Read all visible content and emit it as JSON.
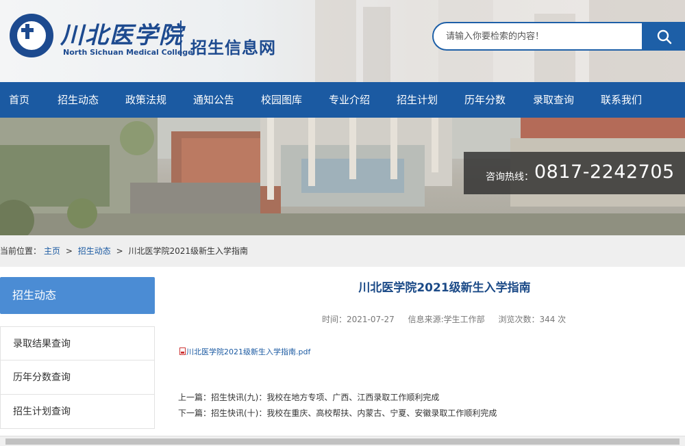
{
  "header": {
    "logo_cn": "川北医学院",
    "logo_en": "North Sichuan Medical College",
    "site_title": "招生信息网",
    "search_placeholder": "请输入你要检索的内容！"
  },
  "nav": {
    "items": [
      "首页",
      "招生动态",
      "政策法规",
      "通知公告",
      "校园图库",
      "专业介绍",
      "招生计划",
      "历年分数",
      "录取查询",
      "联系我们"
    ]
  },
  "banner": {
    "hotline_label": "咨询热线：",
    "hotline_number": "0817-2242705"
  },
  "breadcrumb": {
    "prefix": "当前位置：",
    "home": "主页",
    "sep": ">",
    "section": "招生动态",
    "current": "川北医学院2021级新生入学指南"
  },
  "sidebar": {
    "heading": "招生动态",
    "items": [
      "录取结果查询",
      "历年分数查询",
      "招生计划查询"
    ]
  },
  "article": {
    "title": "川北医学院2021级新生入学指南",
    "time": "时间：2021-07-27",
    "source": "信息来源:学生工作部",
    "views": "浏览次数：344 次",
    "attachment": "川北医学院2021级新生入学指南.pdf",
    "prev": "上一篇：招生快讯(九)：我校在地方专项、广西、江西录取工作顺利完成",
    "next": "下一篇：招生快讯(十)：我校在重庆、高校帮扶、内蒙古、宁夏、安徽录取工作顺利完成"
  },
  "colors": {
    "nav_bg": "#1b5aa2",
    "sidebar_head": "#4b8cd4",
    "title": "#1b4a87"
  }
}
